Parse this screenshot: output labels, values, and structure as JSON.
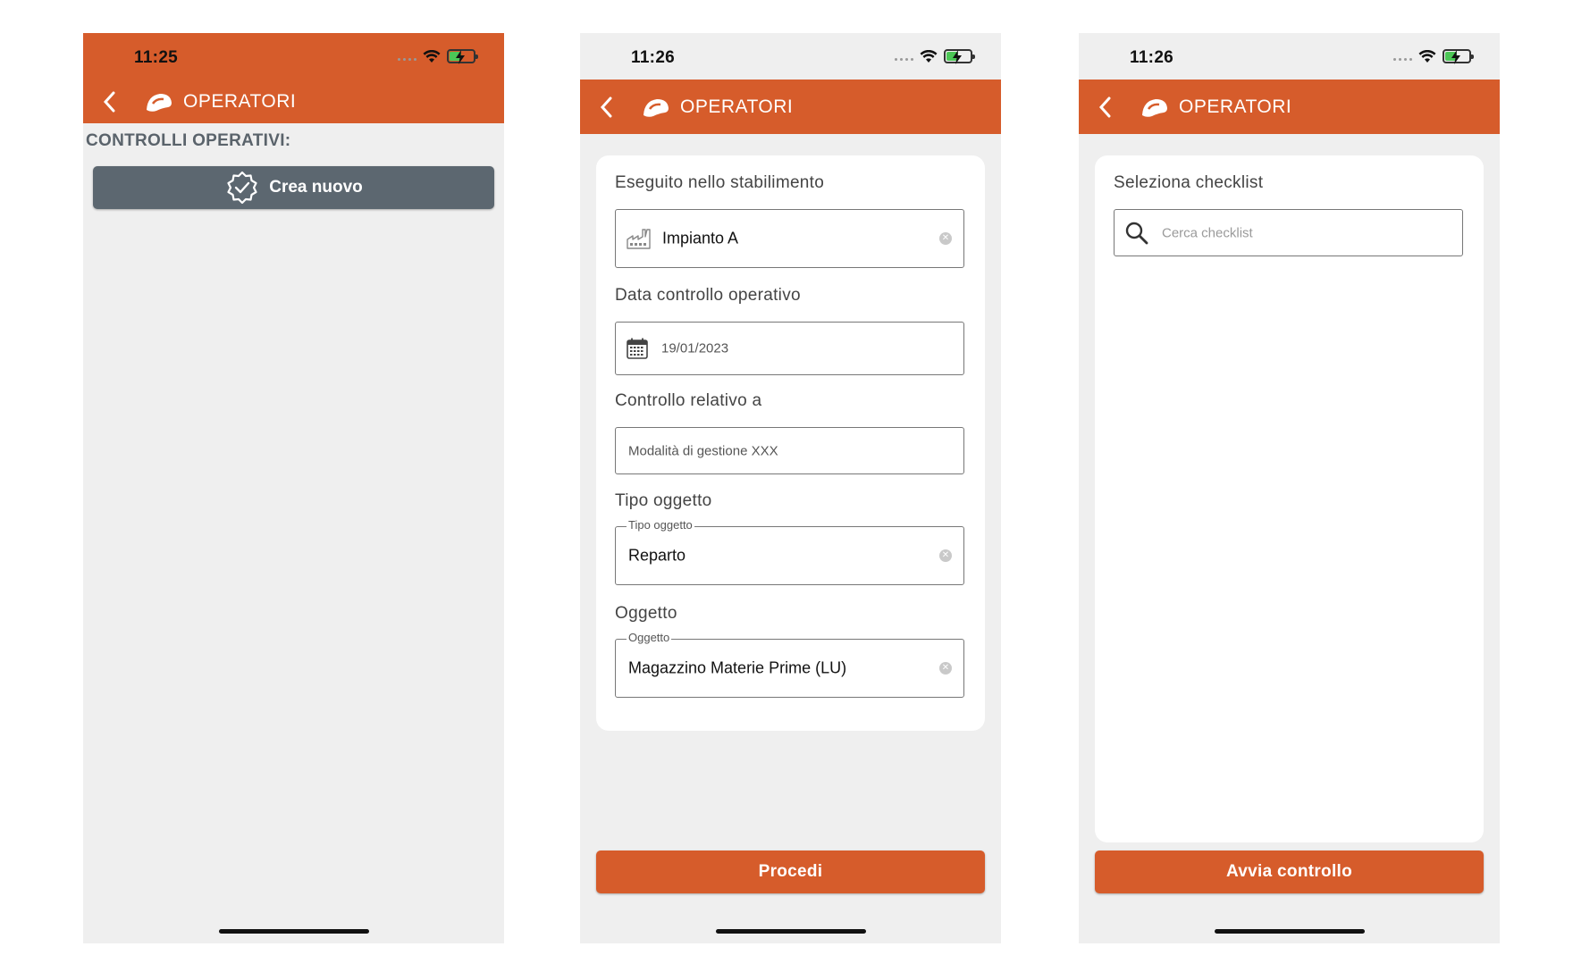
{
  "colors": {
    "brand": "#d65c2b",
    "dark_button": "#5c6770",
    "background": "#efefef"
  },
  "screens": [
    {
      "status_time": "11:25",
      "header_title": "OPERATORI",
      "section_label": "CONTROLLI OPERATIVI:",
      "create_button": "Crea nuovo"
    },
    {
      "status_time": "11:26",
      "header_title": "OPERATORI",
      "fields": [
        {
          "label": "Eseguito nello stabilimento",
          "value": "Impianto A",
          "icon": "factory-icon"
        },
        {
          "label": "Data controllo operativo",
          "value": "19/01/2023",
          "icon": "calendar-icon"
        },
        {
          "label": "Controllo relativo a",
          "value": "Modalità di gestione XXX"
        },
        {
          "label": "Tipo oggetto",
          "legend": "Tipo oggetto",
          "value": "Reparto"
        },
        {
          "label": "Oggetto",
          "legend": "Oggetto",
          "value": "Magazzino Materie Prime (LU)"
        }
      ],
      "proceed_button": "Procedi"
    },
    {
      "status_time": "11:26",
      "header_title": "OPERATORI",
      "field_label": "Seleziona checklist",
      "search_placeholder": "Cerca checklist",
      "start_button": "Avvia controllo"
    }
  ]
}
